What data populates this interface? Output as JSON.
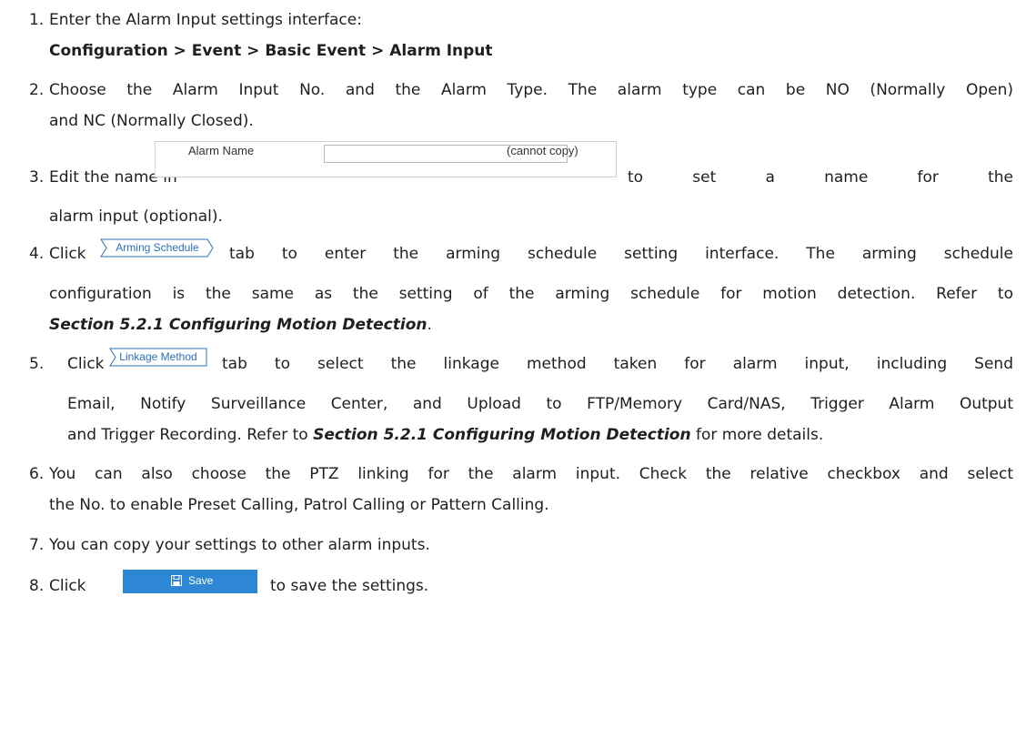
{
  "steps": {
    "s1": {
      "num": "1.",
      "text": "Enter the Alarm Input settings interface:",
      "path": "Configuration > Event > Basic Event > Alarm Input"
    },
    "s2": {
      "num": "2.",
      "line1": "Choose the Alarm Input No. and the Alarm Type. The alarm type can be NO (Normally Open)",
      "line2": "and NC (Normally Closed)."
    },
    "s3": {
      "num": "3.",
      "pre": "Edit the name in",
      "post": "to set a name for the",
      "line2": "alarm input (optional)."
    },
    "s4": {
      "num": "4.",
      "pre": "Click",
      "post": "tab to enter the arming schedule setting interface. The arming schedule",
      "line2": "configuration is the same as the setting of the arming schedule for motion detection. Refer to",
      "ref": "Section 5.2.1 Configuring Motion Detection",
      "ref_end": "."
    },
    "s5": {
      "num": "5.",
      "pre": "Click",
      "post": "tab to select the linkage method taken for alarm input, including Send",
      "line2": "Email, Notify Surveillance Center, and Upload to FTP/Memory Card/NAS, Trigger Alarm Output",
      "line3_pre": "and Trigger Recording. Refer to",
      "ref": "Section 5.2.1 Configuring Motion Detection",
      "line3_post": "for more details."
    },
    "s6": {
      "num": "6.",
      "line1": "You can also choose the PTZ linking for the alarm input. Check the relative checkbox and select",
      "line2": "the No. to enable Preset Calling, Patrol Calling or Pattern Calling."
    },
    "s7": {
      "num": "7.",
      "text": "You can copy your settings to other alarm inputs."
    },
    "s8": {
      "num": "8.",
      "pre": "Click",
      "post": "to save the settings."
    }
  },
  "alarm_name_widget": {
    "label": "Alarm Name",
    "note": "(cannot copy)",
    "value": ""
  },
  "tabs": {
    "arming": "Arming Schedule",
    "linkage": "Linkage Method"
  },
  "save_button": {
    "label": "Save",
    "icon": "floppy-disk-icon",
    "color": "#2d87d4"
  },
  "accent_color": "#2a6fb8"
}
